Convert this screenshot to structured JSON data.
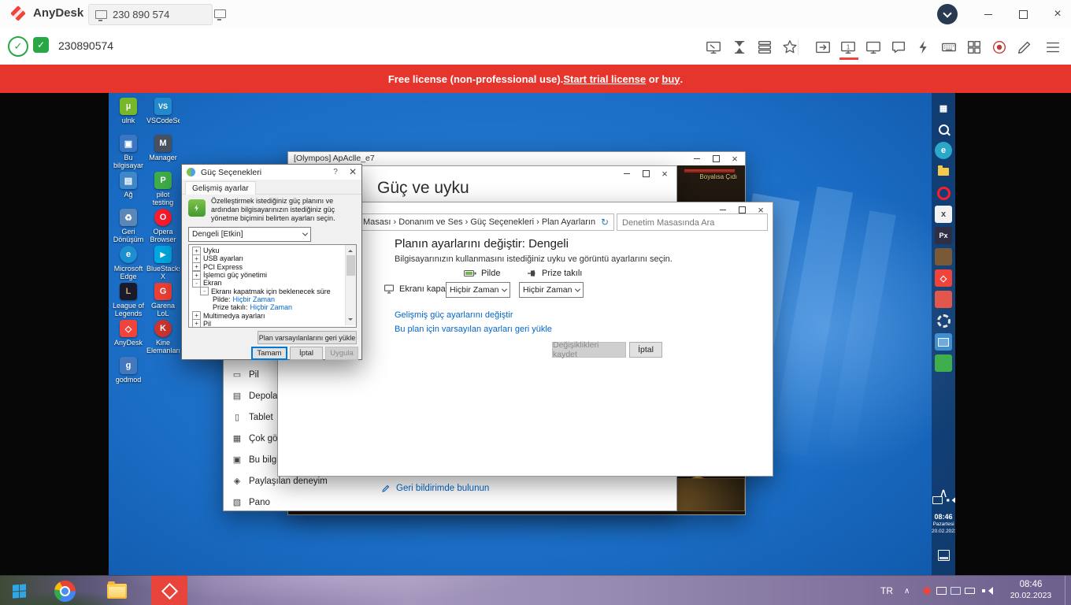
{
  "colors": {
    "anydesk_red": "#ef443b",
    "banner_red": "#e5352d",
    "link_blue": "#0066cc",
    "green": "#28a745",
    "win_blue": "#1a6cc4"
  },
  "titlebar": {
    "brand": "AnyDesk",
    "address_tab": "230 890 574"
  },
  "toolbar": {
    "session_id": "230890574"
  },
  "banner": {
    "prefix": "Free license (non-professional use). ",
    "link_trial": "Start trial license",
    "middle": " or ",
    "link_buy": "buy",
    "suffix": "."
  },
  "desktop_icons": [
    {
      "label": "ulnk",
      "glyph": "µ",
      "bg": "#76b82a"
    },
    {
      "label": "VSCodeSetu...",
      "glyph": "VS",
      "bg": "#2489ca"
    },
    {
      "label": "Bu bilgisayar",
      "glyph": "▣",
      "bg": "#3a76c4"
    },
    {
      "label": "Manager",
      "glyph": "M",
      "bg": "#46505e"
    },
    {
      "label": "Ağ",
      "glyph": "▤",
      "bg": "#3f87c9"
    },
    {
      "label": "pilot testing",
      "glyph": "P",
      "bg": "#3fae49"
    },
    {
      "label": "Geri Dönüşüm",
      "glyph": "♻",
      "bg": "#5b86b8"
    },
    {
      "label": "Opera Browser",
      "glyph": "O",
      "bg": "#ff1b2d"
    },
    {
      "label": "Microsoft Edge",
      "glyph": "e",
      "bg": "#1b8fd0"
    },
    {
      "label": "BlueStacks X",
      "glyph": "▶",
      "bg": "#00a8e1"
    },
    {
      "label": "League of Legends",
      "glyph": "L",
      "bg": "#1a1a2a"
    },
    {
      "label": "Garena LoL",
      "glyph": "G",
      "bg": "#ee4035"
    },
    {
      "label": "AnyDesk",
      "glyph": "◇",
      "bg": "#ef443b"
    },
    {
      "label": "Kine Elemanları",
      "glyph": "K",
      "bg": "#d1342f"
    },
    {
      "label": "godmod",
      "glyph": "g",
      "bg": "#4178be"
    }
  ],
  "olympos": {
    "title": "[Olympos] ApAclle_e7",
    "art_caption": "Boyalısa Çıdı"
  },
  "settings": {
    "heading": "Güç ve uyku",
    "nav": [
      {
        "label": "Pil",
        "glyph": "▭"
      },
      {
        "label": "Depolama",
        "glyph": "▤"
      },
      {
        "label": "Tablet",
        "glyph": "▯"
      },
      {
        "label": "Çok görevli",
        "glyph": "▦"
      },
      {
        "label": "Bu bilgisayara",
        "glyph": "▣"
      },
      {
        "label": "Paylaşılan deneyimler",
        "glyph": "◈"
      },
      {
        "label": "Pano",
        "glyph": "▧"
      }
    ],
    "feedback": "Geri bildirimde bulunun"
  },
  "control_panel": {
    "breadcrumb": "Denetim Masası  ›  Donanım ve Ses  ›  Güç Seçenekleri  ›  Plan Ayarlarını Düzenle",
    "search_placeholder": "Denetim Masasında Ara",
    "heading": "Planın ayarlarını değiştir: Dengeli",
    "subheading": "Bilgisayarınızın kullanmasını istediğiniz uyku ve görüntü ayarlarını seçin.",
    "col_battery": "Pilde",
    "col_plugged": "Prize takılı",
    "screen_off_label": "Ekranı kapat:",
    "select_battery": "Hiçbir Zaman",
    "select_plugged": "Hiçbir Zaman",
    "link_advanced": "Gelişmiş güç ayarlarını değiştir",
    "link_restore": "Bu plan için varsayılan ayarları geri yükle",
    "save_button": "Değişiklikleri kaydet",
    "cancel_button": "İptal"
  },
  "power_dialog": {
    "title": "Güç Seçenekleri",
    "tab": "Gelişmiş ayarlar",
    "intro": "Özelleştirmek istediğiniz güç planını ve ardından bilgisayarınızın istediğiniz güç yönetme biçimini belirten ayarları seçin.",
    "plan_combo": "Dengeli [Etkin]",
    "tree": [
      {
        "label": "Uyku",
        "exp": "+"
      },
      {
        "label": "USB ayarları",
        "exp": "+"
      },
      {
        "label": "PCI Express",
        "exp": "+"
      },
      {
        "label": "İşlemci güç yönetimi",
        "exp": "+"
      },
      {
        "label": "Ekran",
        "exp": "-"
      },
      {
        "label": "Ekranı kapatmak için beklenecek süre",
        "exp": "-"
      },
      {
        "label": "Pilde:",
        "value": "Hiçbir Zaman"
      },
      {
        "label": "Prize takılı:",
        "value": "Hiçbir Zaman"
      },
      {
        "label": "Multimedya ayarları",
        "exp": "+"
      },
      {
        "label": "Pil",
        "exp": "+"
      }
    ],
    "restore_button": "Plan varsayılanlarını geri yükle",
    "ok": "Tamam",
    "cancel": "İptal",
    "apply": "Uygula"
  },
  "remote_taskbar_icons": [
    {
      "name": "task-view",
      "glyph": "▦",
      "bg": "none"
    },
    {
      "name": "search",
      "glyph": "",
      "bg": "none"
    },
    {
      "name": "edge",
      "glyph": "e",
      "bg": "#2aa7c9"
    },
    {
      "name": "file-explorer",
      "glyph": "",
      "bg": "none"
    },
    {
      "name": "opera",
      "glyph": "",
      "bg": "none"
    },
    {
      "name": "app-x",
      "glyph": "x",
      "bg": "#f2f2f2"
    },
    {
      "name": "px-app",
      "glyph": "Px",
      "bg": "#2e2e44"
    },
    {
      "name": "game-app",
      "glyph": "",
      "bg": "#7a5a36"
    },
    {
      "name": "anydesk",
      "glyph": "◇",
      "bg": "#ef443b"
    },
    {
      "name": "media-app",
      "glyph": "",
      "bg": "#e2574c"
    },
    {
      "name": "settings-gear",
      "glyph": "",
      "bg": "none"
    },
    {
      "name": "display-app",
      "glyph": "",
      "bg": "#3f8fd2"
    },
    {
      "name": "green-app",
      "glyph": "",
      "bg": "#3faf4e"
    }
  ],
  "remote_tray": {
    "time": "08:46",
    "day": "Pazartesi",
    "date": "20.02.2023"
  },
  "taskbar": {
    "lang": "TR",
    "time": "08:46",
    "date": "20.02.2023"
  }
}
